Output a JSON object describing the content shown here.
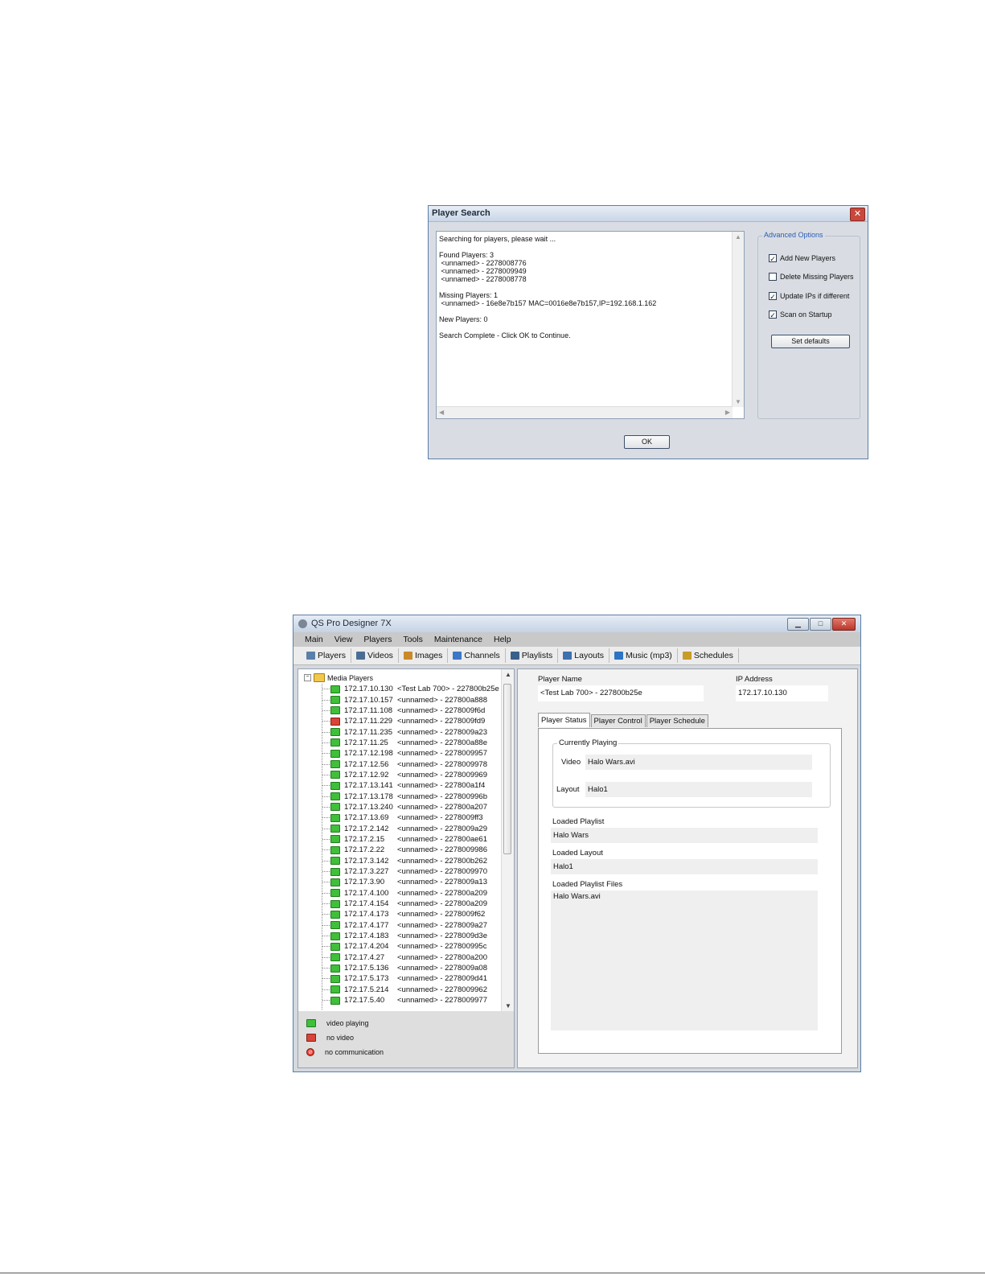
{
  "search_dialog": {
    "title": "Player Search",
    "close_glyph": "✕",
    "log_lines": [
      "Searching for players, please wait ...",
      "",
      "Found Players: 3",
      " <unnamed> - 2278008776",
      " <unnamed> - 2278009949",
      " <unnamed> - 2278008778",
      "",
      "Missing Players: 1",
      " <unnamed> - 16e8e7b157 MAC=0016e8e7b157,IP=192.168.1.162",
      "",
      "New Players: 0",
      "",
      "Search Complete - Click OK to Continue."
    ],
    "advanced_title": "Advanced Options",
    "options": [
      {
        "label": "Add New Players",
        "checked": true
      },
      {
        "label": "Delete Missing Players",
        "checked": false
      },
      {
        "label": "Update IPs if different",
        "checked": true
      },
      {
        "label": "Scan on Startup",
        "checked": true
      }
    ],
    "set_defaults_label": "Set defaults",
    "ok_label": "OK"
  },
  "main_window": {
    "title": "QS Pro Designer 7X",
    "menu": [
      "Main",
      "View",
      "Players",
      "Tools",
      "Maintenance",
      "Help"
    ],
    "toolbar": [
      {
        "label": "Players",
        "icon": "players-icon",
        "color": "#5a7fa8"
      },
      {
        "label": "Videos",
        "icon": "film-icon",
        "color": "#4a6e93"
      },
      {
        "label": "Images",
        "icon": "images-icon",
        "color": "#c98a2a"
      },
      {
        "label": "Channels",
        "icon": "tv-icon",
        "color": "#3c77c8"
      },
      {
        "label": "Playlists",
        "icon": "list-icon",
        "color": "#3a5f8a"
      },
      {
        "label": "Layouts",
        "icon": "layout-icon",
        "color": "#3f6fae"
      },
      {
        "label": "Music (mp3)",
        "icon": "music-note-icon",
        "color": "#2d74c4"
      },
      {
        "label": "Schedules",
        "icon": "clock-icon",
        "color": "#c99b2a"
      }
    ],
    "tree_root": "Media Players",
    "players": [
      {
        "ip": "172.17.10.130",
        "name": "<Test Lab 700> - 227800b25e",
        "status": "green"
      },
      {
        "ip": "172.17.10.157",
        "name": "<unnamed> - 227800a888",
        "status": "green"
      },
      {
        "ip": "172.17.11.108",
        "name": "<unnamed> - 2278009f6d",
        "status": "green"
      },
      {
        "ip": "172.17.11.229",
        "name": "<unnamed> - 2278009fd9",
        "status": "red"
      },
      {
        "ip": "172.17.11.235",
        "name": "<unnamed> - 2278009a23",
        "status": "green"
      },
      {
        "ip": "172.17.11.25",
        "name": "<unnamed> - 227800a88e",
        "status": "green"
      },
      {
        "ip": "172.17.12.198",
        "name": "<unnamed> - 2278009957",
        "status": "green"
      },
      {
        "ip": "172.17.12.56",
        "name": "<unnamed> - 2278009978",
        "status": "green"
      },
      {
        "ip": "172.17.12.92",
        "name": "<unnamed> - 2278009969",
        "status": "green"
      },
      {
        "ip": "172.17.13.141",
        "name": "<unnamed> - 227800a1f4",
        "status": "green"
      },
      {
        "ip": "172.17.13.178",
        "name": "<unnamed> - 227800996b",
        "status": "green"
      },
      {
        "ip": "172.17.13.240",
        "name": "<unnamed> - 227800a207",
        "status": "green"
      },
      {
        "ip": "172.17.13.69",
        "name": "<unnamed> - 2278009ff3",
        "status": "green"
      },
      {
        "ip": "172.17.2.142",
        "name": "<unnamed> - 2278009a29",
        "status": "green"
      },
      {
        "ip": "172.17.2.15",
        "name": "<unnamed> - 227800ae61",
        "status": "green"
      },
      {
        "ip": "172.17.2.22",
        "name": "<unnamed> - 2278009986",
        "status": "green"
      },
      {
        "ip": "172.17.3.142",
        "name": "<unnamed> - 227800b262",
        "status": "green"
      },
      {
        "ip": "172.17.3.227",
        "name": "<unnamed> - 2278009970",
        "status": "green"
      },
      {
        "ip": "172.17.3.90",
        "name": "<unnamed> - 2278009a13",
        "status": "green"
      },
      {
        "ip": "172.17.4.100",
        "name": "<unnamed> - 227800a209",
        "status": "green"
      },
      {
        "ip": "172.17.4.154",
        "name": "<unnamed> - 227800a209",
        "status": "green"
      },
      {
        "ip": "172.17.4.173",
        "name": "<unnamed> - 2278009f62",
        "status": "green"
      },
      {
        "ip": "172.17.4.177",
        "name": "<unnamed> - 2278009a27",
        "status": "green"
      },
      {
        "ip": "172.17.4.183",
        "name": "<unnamed> - 2278009d3e",
        "status": "green"
      },
      {
        "ip": "172.17.4.204",
        "name": "<unnamed> - 227800995c",
        "status": "green"
      },
      {
        "ip": "172.17.4.27",
        "name": "<unnamed> - 227800a200",
        "status": "green"
      },
      {
        "ip": "172.17.5.136",
        "name": "<unnamed> - 2278009a08",
        "status": "green"
      },
      {
        "ip": "172.17.5.173",
        "name": "<unnamed> - 2278009d41",
        "status": "green"
      },
      {
        "ip": "172.17.5.214",
        "name": "<unnamed> - 2278009962",
        "status": "green"
      },
      {
        "ip": "172.17.5.40",
        "name": "<unnamed> - 2278009977",
        "status": "green"
      }
    ],
    "legend": [
      {
        "label": "video playing",
        "icon": "monitor-green-icon"
      },
      {
        "label": "no video",
        "icon": "monitor-red-icon"
      },
      {
        "label": "no communication",
        "icon": "no-entry-icon"
      }
    ],
    "player_name_label": "Player Name",
    "player_name_value": "<Test Lab 700> - 227800b25e",
    "ip_label": "IP Address",
    "ip_value": "172.17.10.130",
    "tabs": [
      "Player Status",
      "Player Control",
      "Player Schedule"
    ],
    "currently_playing_title": "Currently Playing",
    "video_label": "Video",
    "video_value": "Halo Wars.avi",
    "layout_label": "Layout",
    "layout_value": "Halo1",
    "loaded_playlist_label": "Loaded Playlist",
    "loaded_playlist_value": "Halo Wars",
    "loaded_layout_label": "Loaded Layout",
    "loaded_layout_value": "Halo1",
    "loaded_files_label": "Loaded Playlist Files",
    "loaded_files_value": "Halo Wars.avi"
  }
}
